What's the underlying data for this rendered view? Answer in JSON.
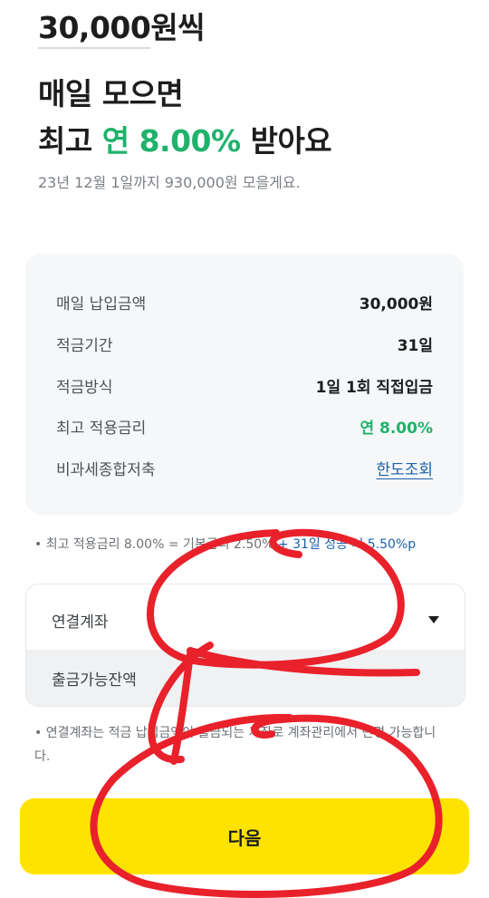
{
  "header": {
    "amount": "30,000",
    "amount_suffix": "원씩",
    "line1": "매일 모으면",
    "line2_prefix": "최고",
    "line2_rate": "연 8.00%",
    "line2_suffix": "받아요",
    "subtext": "23년 12월 1일까지 930,000원 모을게요."
  },
  "summary": {
    "rows": [
      {
        "label": "매일 납입금액",
        "value": "30,000원"
      },
      {
        "label": "적금기간",
        "value": "31일"
      },
      {
        "label": "적금방식",
        "value": "1일 1회 직접입금"
      },
      {
        "label": "최고 적용금리",
        "value": "연 8.00%"
      },
      {
        "label": "비과세종합저축",
        "value": "한도조회"
      }
    ]
  },
  "rate_note": {
    "bullet": "•",
    "text": "최고 적용금리 8.00% = 기본금리 2.50%",
    "highlight": "+ 31일 성공 시 5.50%p"
  },
  "account": {
    "linked_label": "연결계좌",
    "balance_label": "출금가능잔액"
  },
  "account_note": {
    "bullet": "•",
    "text": "연결계좌는 적금 납입금액이 출금되는 계좌로 계좌관리에서 변경 가능합니다."
  },
  "next_button": {
    "label": "다음"
  },
  "colors": {
    "accent_green": "#20b26b",
    "button_yellow": "#ffe300",
    "link_blue": "#1c5fa8",
    "annotation_red": "#e8212b"
  }
}
